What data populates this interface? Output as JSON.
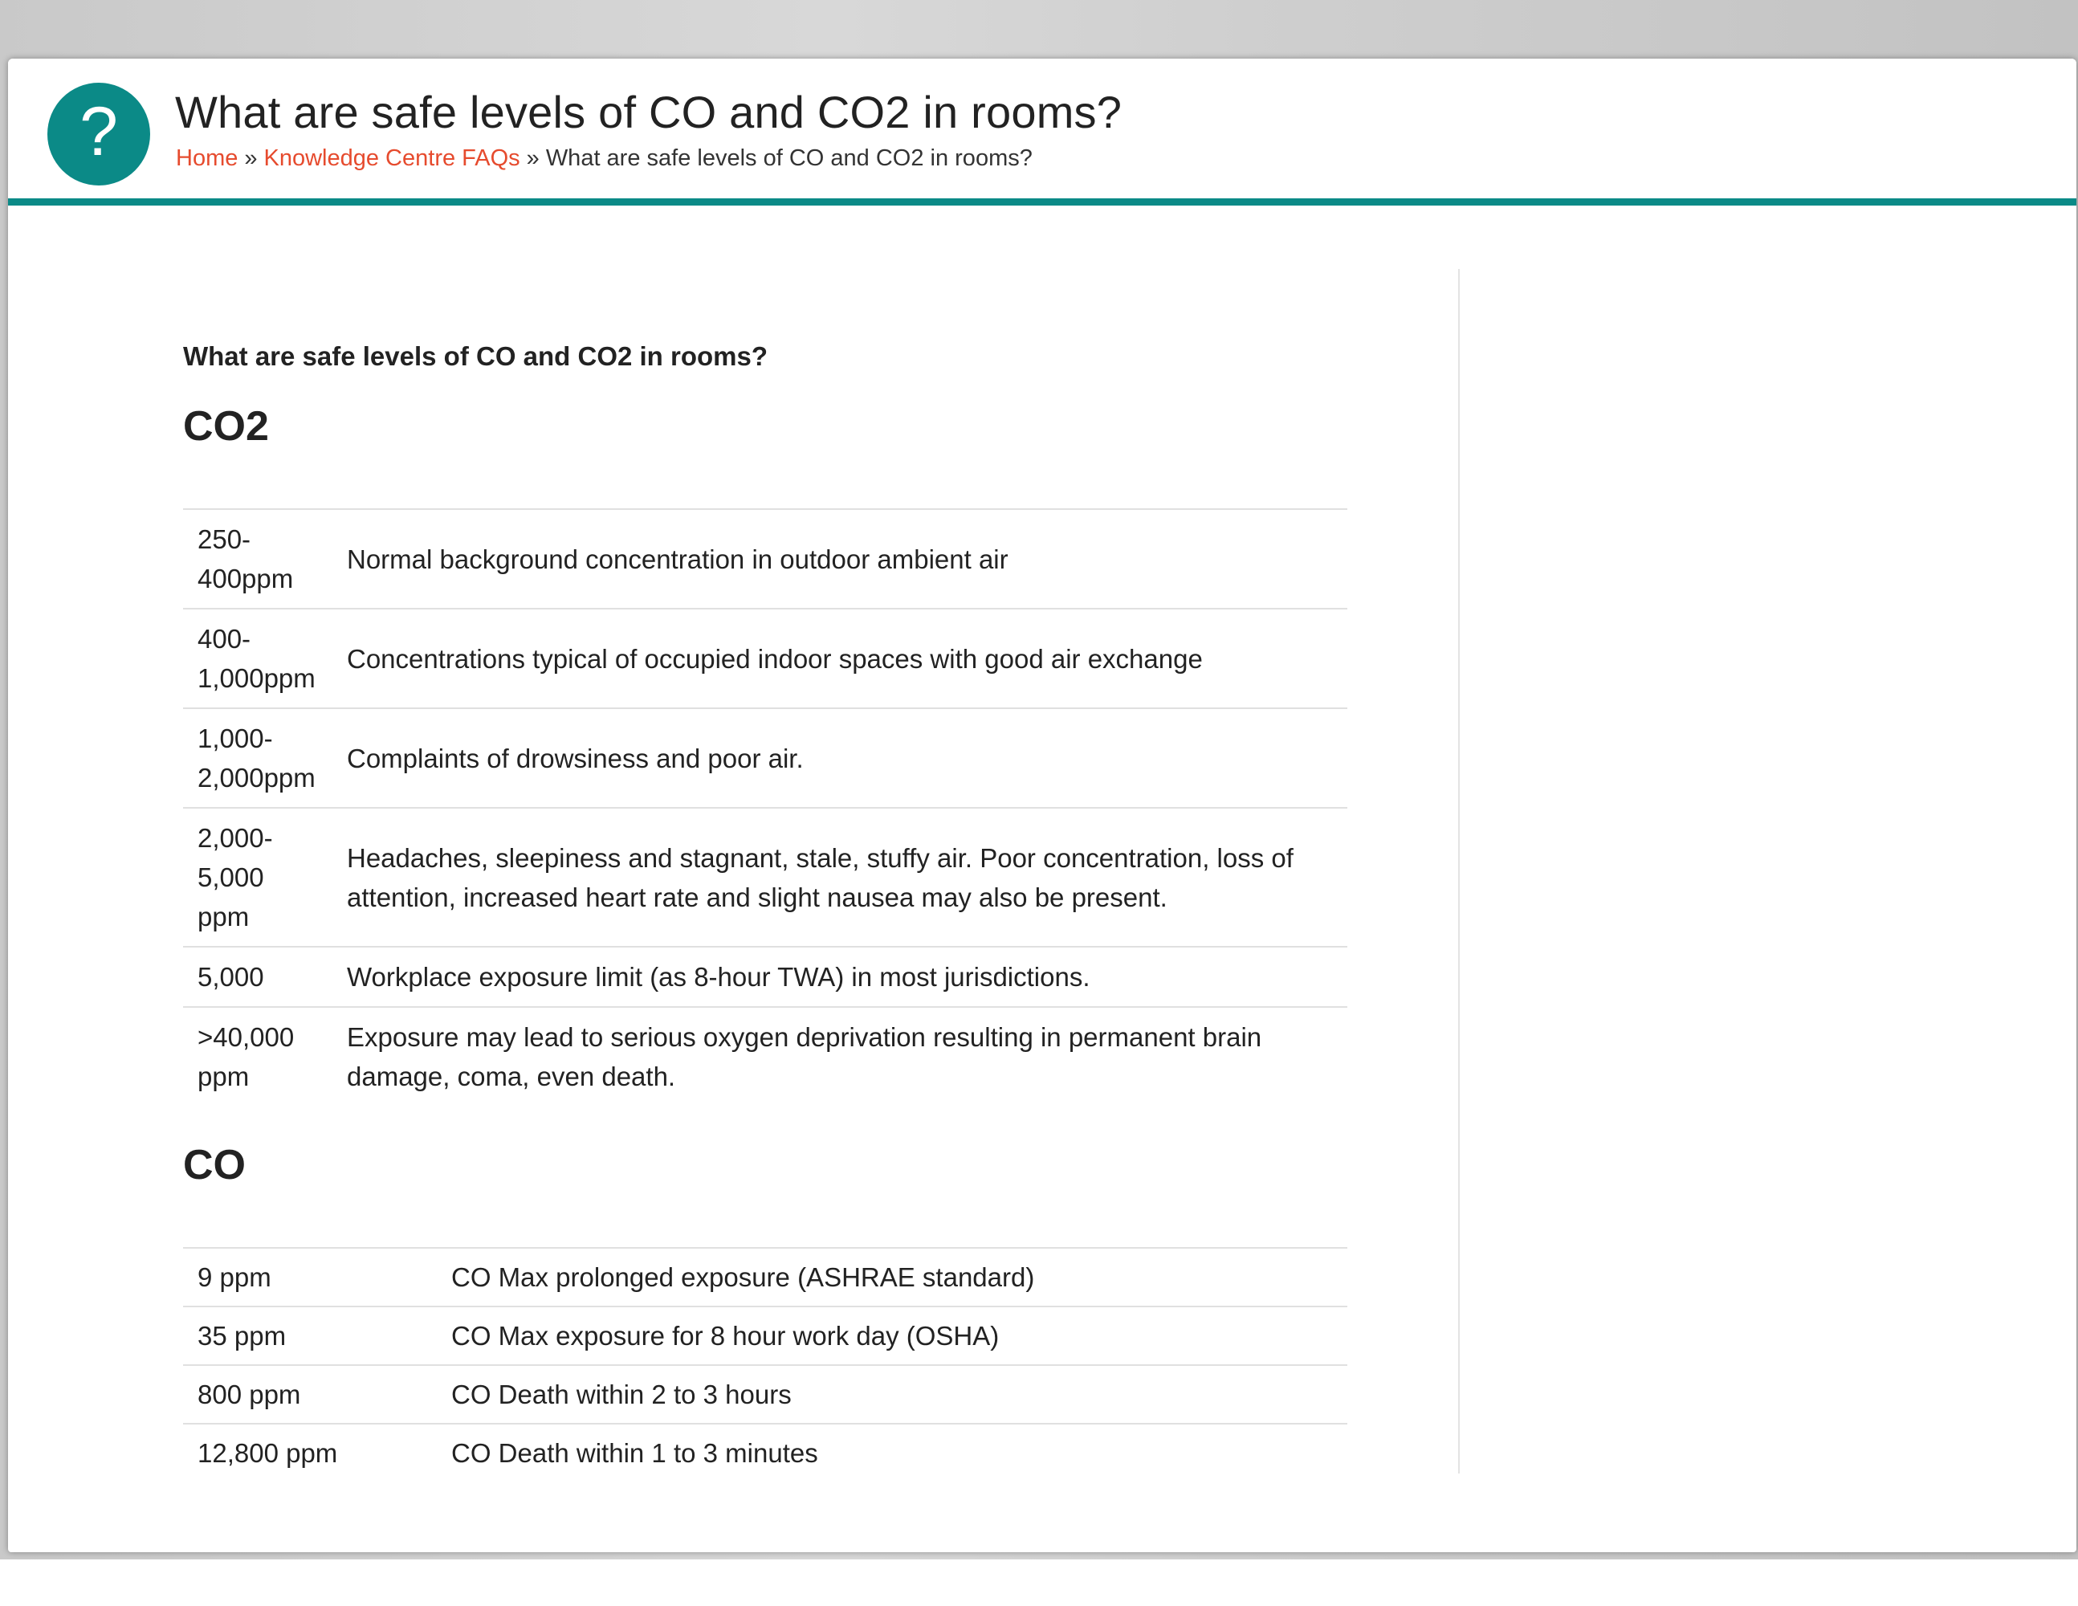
{
  "page": {
    "title": "What are safe levels of CO and CO2 in rooms?",
    "icon": "question-mark-icon",
    "accent_color": "#0b8a87",
    "link_color": "#e64b2e"
  },
  "breadcrumb": {
    "home": "Home",
    "separator": "»",
    "faqs": "Knowledge Centre FAQs",
    "current": "What are safe levels of CO and CO2 in rooms?"
  },
  "article": {
    "question": "What are safe levels of CO and CO2 in rooms?",
    "co2": {
      "heading": "CO2",
      "rows": [
        {
          "level": "250-400ppm",
          "description": "Normal background concentration in outdoor ambient air"
        },
        {
          "level": "400-1,000ppm",
          "description": "Concentrations typical of occupied indoor spaces with good air exchange"
        },
        {
          "level": "1,000-2,000ppm",
          "description": "Complaints of drowsiness and poor air."
        },
        {
          "level": "2,000-5,000 ppm",
          "description": "Headaches, sleepiness and stagnant, stale, stuffy air. Poor concentration, loss of attention, increased heart rate and slight nausea may also be present."
        },
        {
          "level": "5,000",
          "description": "Workplace exposure limit (as 8-hour TWA) in most jurisdictions."
        },
        {
          "level": ">40,000 ppm",
          "description": "Exposure may lead to serious oxygen deprivation resulting in permanent brain damage, coma, even death."
        }
      ]
    },
    "co": {
      "heading": "CO",
      "rows": [
        {
          "level": "9 ppm",
          "description": "CO Max prolonged exposure (ASHRAE standard)"
        },
        {
          "level": "35 ppm",
          "description": "CO Max exposure for 8 hour work day (OSHA)"
        },
        {
          "level": "800 ppm",
          "description": "CO Death within 2 to 3 hours"
        },
        {
          "level": "12,800 ppm",
          "description": "CO Death within 1 to 3 minutes"
        }
      ]
    }
  }
}
